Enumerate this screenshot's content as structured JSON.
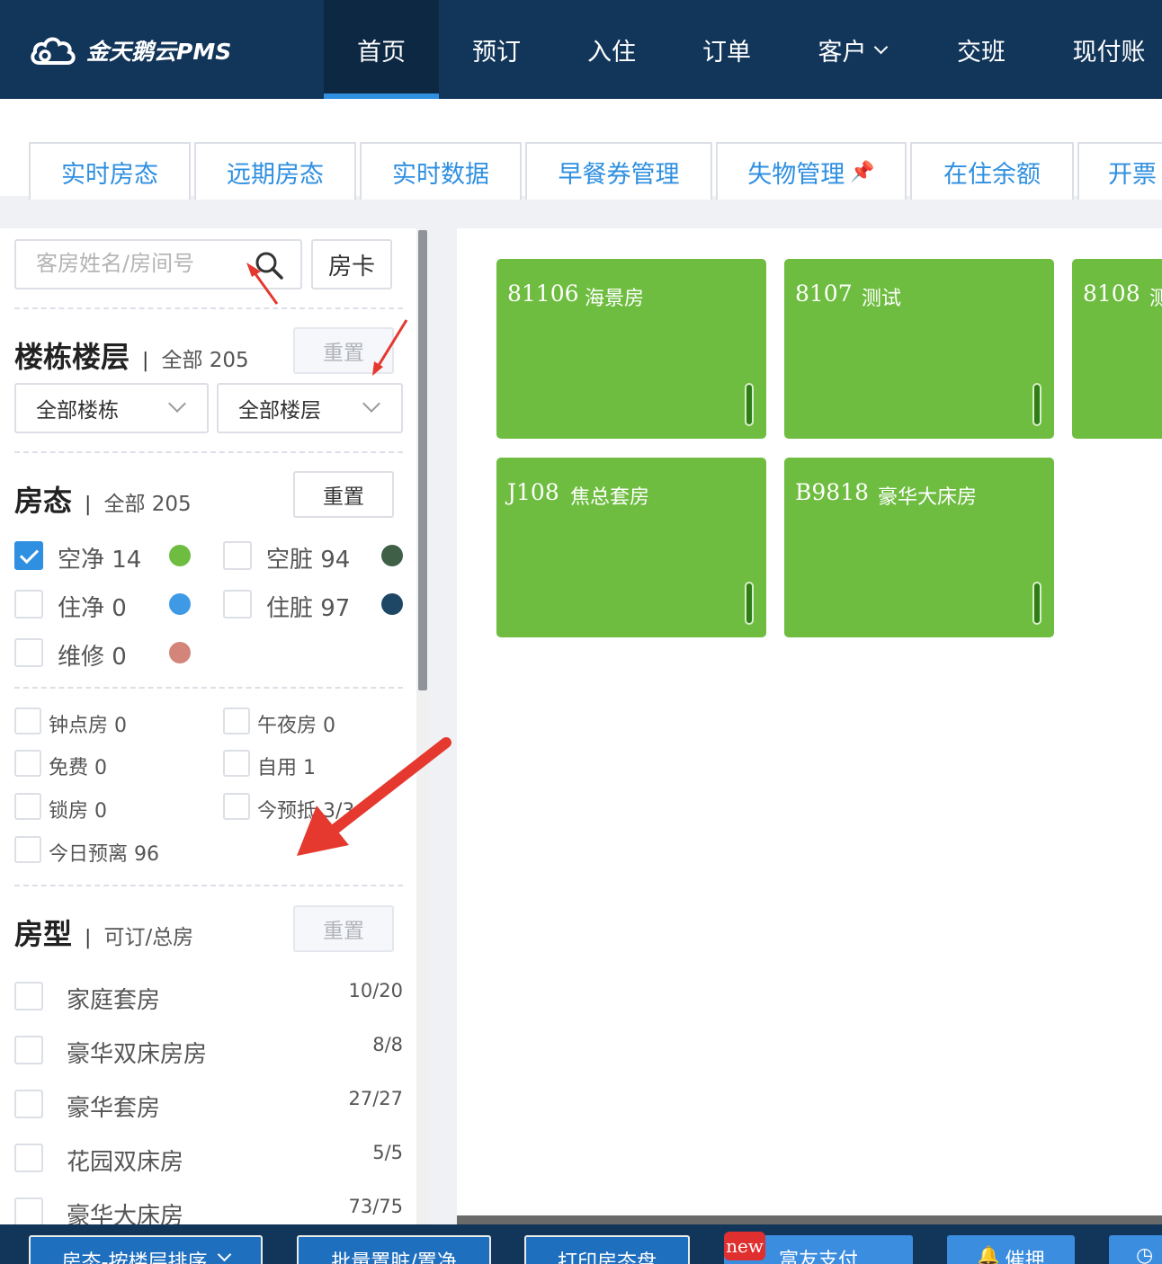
{
  "app": {
    "logo_text": "金天鹅云PMS"
  },
  "nav": {
    "items": [
      {
        "label": "首页",
        "active": true
      },
      {
        "label": "预订"
      },
      {
        "label": "入住"
      },
      {
        "label": "订单"
      },
      {
        "label": "客户",
        "dropdown": true
      },
      {
        "label": "交班"
      },
      {
        "label": "现付账"
      }
    ]
  },
  "tabs": [
    "实时房态",
    "远期房态",
    "实时数据",
    "早餐券管理",
    "失物管理",
    "在住余额",
    "开票"
  ],
  "sidebar": {
    "search_placeholder": "客房姓名/房间号",
    "card_button": "房卡",
    "building": {
      "title": "楼栋楼层",
      "sub": "全部 205",
      "reset": "重置",
      "building_select": "全部楼栋",
      "floor_select": "全部楼层"
    },
    "status": {
      "title": "房态",
      "sub": "全部 205",
      "reset": "重置",
      "items": [
        {
          "label": "空净 14",
          "checked": true,
          "color": "#6ebd40"
        },
        {
          "label": "空脏 94",
          "checked": false,
          "color": "#3f5f46"
        },
        {
          "label": "住净 0",
          "checked": false,
          "color": "#3f9ae6"
        },
        {
          "label": "住脏 97",
          "checked": false,
          "color": "#1e4766"
        },
        {
          "label": "维修 0",
          "checked": false,
          "color": "#d3857a"
        }
      ]
    },
    "flags": [
      {
        "label": "钟点房 0"
      },
      {
        "label": "午夜房 0"
      },
      {
        "label": "免费 0"
      },
      {
        "label": "自用 1"
      },
      {
        "label": "锁房 0"
      },
      {
        "label": "今预抵 3/3"
      },
      {
        "label": "今日预离 96"
      }
    ],
    "room_types": {
      "title": "房型",
      "sub": "可订/总房",
      "reset": "重置",
      "items": [
        {
          "label": "家庭套房",
          "count": "10/20"
        },
        {
          "label": "豪华双床房房",
          "count": "8/8"
        },
        {
          "label": "豪华套房",
          "count": "27/27"
        },
        {
          "label": "花园双床房",
          "count": "5/5"
        },
        {
          "label": "豪华大床房",
          "count": "73/75"
        }
      ]
    }
  },
  "rooms": [
    {
      "no": "81106",
      "type": "海景房"
    },
    {
      "no": "8107",
      "type": "测试"
    },
    {
      "no": "8108",
      "type": "测"
    },
    {
      "no": "J108",
      "type": "焦总套房"
    },
    {
      "no": "B9818",
      "type": "豪华大床房"
    }
  ],
  "bottom": {
    "sort_button": "房态-按楼层排序",
    "batch_button": "批量置脏/置净",
    "print_button": "打印房态盘",
    "new_badge": "new",
    "pay_button": "富友支付",
    "remind_button": "催押"
  }
}
